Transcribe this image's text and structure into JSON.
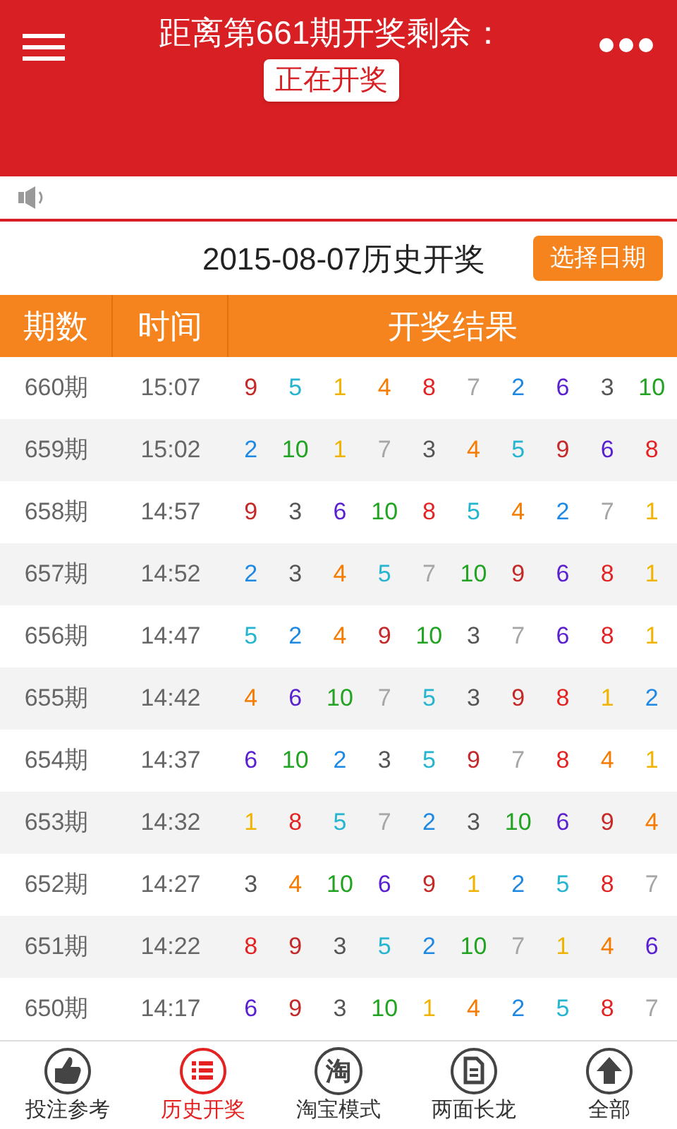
{
  "header": {
    "title": "距离第661期开奖剩余：",
    "status": "正在开奖"
  },
  "history": {
    "title": "2015-08-07历史开奖",
    "date_button": "选择日期"
  },
  "table": {
    "columns": [
      "期数",
      "时间",
      "开奖结果"
    ],
    "rows": [
      {
        "period": "660期",
        "time": "15:07",
        "results": [
          {
            "n": "9",
            "color": "#c62828"
          },
          {
            "n": "5",
            "color": "#26b5d0"
          },
          {
            "n": "1",
            "color": "#f0b400"
          },
          {
            "n": "4",
            "color": "#f57c00"
          },
          {
            "n": "8",
            "color": "#e52222"
          },
          {
            "n": "7",
            "color": "#a6a6a6"
          },
          {
            "n": "2",
            "color": "#1e88e5"
          },
          {
            "n": "6",
            "color": "#5a1fd1"
          },
          {
            "n": "3",
            "color": "#555555"
          },
          {
            "n": "10",
            "color": "#22a322"
          }
        ]
      },
      {
        "period": "659期",
        "time": "15:02",
        "results": [
          {
            "n": "2",
            "color": "#1e88e5"
          },
          {
            "n": "10",
            "color": "#22a322"
          },
          {
            "n": "1",
            "color": "#f0b400"
          },
          {
            "n": "7",
            "color": "#a6a6a6"
          },
          {
            "n": "3",
            "color": "#555555"
          },
          {
            "n": "4",
            "color": "#f57c00"
          },
          {
            "n": "5",
            "color": "#26b5d0"
          },
          {
            "n": "9",
            "color": "#c62828"
          },
          {
            "n": "6",
            "color": "#5a1fd1"
          },
          {
            "n": "8",
            "color": "#e52222"
          }
        ]
      },
      {
        "period": "658期",
        "time": "14:57",
        "results": [
          {
            "n": "9",
            "color": "#c62828"
          },
          {
            "n": "3",
            "color": "#555555"
          },
          {
            "n": "6",
            "color": "#5a1fd1"
          },
          {
            "n": "10",
            "color": "#22a322"
          },
          {
            "n": "8",
            "color": "#e52222"
          },
          {
            "n": "5",
            "color": "#26b5d0"
          },
          {
            "n": "4",
            "color": "#f57c00"
          },
          {
            "n": "2",
            "color": "#1e88e5"
          },
          {
            "n": "7",
            "color": "#a6a6a6"
          },
          {
            "n": "1",
            "color": "#f0b400"
          }
        ]
      },
      {
        "period": "657期",
        "time": "14:52",
        "results": [
          {
            "n": "2",
            "color": "#1e88e5"
          },
          {
            "n": "3",
            "color": "#555555"
          },
          {
            "n": "4",
            "color": "#f57c00"
          },
          {
            "n": "5",
            "color": "#26b5d0"
          },
          {
            "n": "7",
            "color": "#a6a6a6"
          },
          {
            "n": "10",
            "color": "#22a322"
          },
          {
            "n": "9",
            "color": "#c62828"
          },
          {
            "n": "6",
            "color": "#5a1fd1"
          },
          {
            "n": "8",
            "color": "#e52222"
          },
          {
            "n": "1",
            "color": "#f0b400"
          }
        ]
      },
      {
        "period": "656期",
        "time": "14:47",
        "results": [
          {
            "n": "5",
            "color": "#26b5d0"
          },
          {
            "n": "2",
            "color": "#1e88e5"
          },
          {
            "n": "4",
            "color": "#f57c00"
          },
          {
            "n": "9",
            "color": "#c62828"
          },
          {
            "n": "10",
            "color": "#22a322"
          },
          {
            "n": "3",
            "color": "#555555"
          },
          {
            "n": "7",
            "color": "#a6a6a6"
          },
          {
            "n": "6",
            "color": "#5a1fd1"
          },
          {
            "n": "8",
            "color": "#e52222"
          },
          {
            "n": "1",
            "color": "#f0b400"
          }
        ]
      },
      {
        "period": "655期",
        "time": "14:42",
        "results": [
          {
            "n": "4",
            "color": "#f57c00"
          },
          {
            "n": "6",
            "color": "#5a1fd1"
          },
          {
            "n": "10",
            "color": "#22a322"
          },
          {
            "n": "7",
            "color": "#a6a6a6"
          },
          {
            "n": "5",
            "color": "#26b5d0"
          },
          {
            "n": "3",
            "color": "#555555"
          },
          {
            "n": "9",
            "color": "#c62828"
          },
          {
            "n": "8",
            "color": "#e52222"
          },
          {
            "n": "1",
            "color": "#f0b400"
          },
          {
            "n": "2",
            "color": "#1e88e5"
          }
        ]
      },
      {
        "period": "654期",
        "time": "14:37",
        "results": [
          {
            "n": "6",
            "color": "#5a1fd1"
          },
          {
            "n": "10",
            "color": "#22a322"
          },
          {
            "n": "2",
            "color": "#1e88e5"
          },
          {
            "n": "3",
            "color": "#555555"
          },
          {
            "n": "5",
            "color": "#26b5d0"
          },
          {
            "n": "9",
            "color": "#c62828"
          },
          {
            "n": "7",
            "color": "#a6a6a6"
          },
          {
            "n": "8",
            "color": "#e52222"
          },
          {
            "n": "4",
            "color": "#f57c00"
          },
          {
            "n": "1",
            "color": "#f0b400"
          }
        ]
      },
      {
        "period": "653期",
        "time": "14:32",
        "results": [
          {
            "n": "1",
            "color": "#f0b400"
          },
          {
            "n": "8",
            "color": "#e52222"
          },
          {
            "n": "5",
            "color": "#26b5d0"
          },
          {
            "n": "7",
            "color": "#a6a6a6"
          },
          {
            "n": "2",
            "color": "#1e88e5"
          },
          {
            "n": "3",
            "color": "#555555"
          },
          {
            "n": "10",
            "color": "#22a322"
          },
          {
            "n": "6",
            "color": "#5a1fd1"
          },
          {
            "n": "9",
            "color": "#c62828"
          },
          {
            "n": "4",
            "color": "#f57c00"
          }
        ]
      },
      {
        "period": "652期",
        "time": "14:27",
        "results": [
          {
            "n": "3",
            "color": "#555555"
          },
          {
            "n": "4",
            "color": "#f57c00"
          },
          {
            "n": "10",
            "color": "#22a322"
          },
          {
            "n": "6",
            "color": "#5a1fd1"
          },
          {
            "n": "9",
            "color": "#c62828"
          },
          {
            "n": "1",
            "color": "#f0b400"
          },
          {
            "n": "2",
            "color": "#1e88e5"
          },
          {
            "n": "5",
            "color": "#26b5d0"
          },
          {
            "n": "8",
            "color": "#e52222"
          },
          {
            "n": "7",
            "color": "#a6a6a6"
          }
        ]
      },
      {
        "period": "651期",
        "time": "14:22",
        "results": [
          {
            "n": "8",
            "color": "#e52222"
          },
          {
            "n": "9",
            "color": "#c62828"
          },
          {
            "n": "3",
            "color": "#555555"
          },
          {
            "n": "5",
            "color": "#26b5d0"
          },
          {
            "n": "2",
            "color": "#1e88e5"
          },
          {
            "n": "10",
            "color": "#22a322"
          },
          {
            "n": "7",
            "color": "#a6a6a6"
          },
          {
            "n": "1",
            "color": "#f0b400"
          },
          {
            "n": "4",
            "color": "#f57c00"
          },
          {
            "n": "6",
            "color": "#5a1fd1"
          }
        ]
      },
      {
        "period": "650期",
        "time": "14:17",
        "results": [
          {
            "n": "6",
            "color": "#5a1fd1"
          },
          {
            "n": "9",
            "color": "#c62828"
          },
          {
            "n": "3",
            "color": "#555555"
          },
          {
            "n": "10",
            "color": "#22a322"
          },
          {
            "n": "1",
            "color": "#f0b400"
          },
          {
            "n": "4",
            "color": "#f57c00"
          },
          {
            "n": "2",
            "color": "#1e88e5"
          },
          {
            "n": "5",
            "color": "#26b5d0"
          },
          {
            "n": "8",
            "color": "#e52222"
          },
          {
            "n": "7",
            "color": "#a6a6a6"
          }
        ]
      }
    ]
  },
  "bottom_nav": [
    {
      "kind": "thumb",
      "label": "投注参考",
      "selected": false
    },
    {
      "kind": "list",
      "label": "历史开奖",
      "selected": true
    },
    {
      "kind": "glyph",
      "glyph": "淘",
      "label": "淘宝模式",
      "selected": false
    },
    {
      "kind": "document",
      "label": "两面长龙",
      "selected": false
    },
    {
      "kind": "arrow",
      "label": "全部",
      "selected": false
    }
  ]
}
